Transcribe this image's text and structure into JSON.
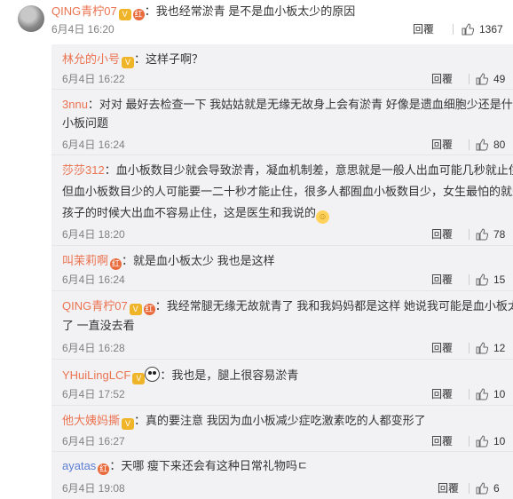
{
  "top_comment": {
    "user": "QING青柠07",
    "text": "：我也经常淤青 是不是血小板太少的原因",
    "time": "6月4日 16:20",
    "reply": "回覆",
    "likes": "1367"
  },
  "replies": [
    {
      "user": "林允的小号",
      "user_color": "#eb7350",
      "lines": [
        "：这样子啊？"
      ],
      "time": "6月4日 16:22",
      "reply": "回覆",
      "likes": "49"
    },
    {
      "user": "3nnu",
      "user_color": "#eb7350",
      "lines": [
        "：对对 最好去检查一下 我姑姑就是无缘无故身上会有淤青 好像是遗血细胞少还是什么血",
        "小板问题"
      ],
      "time": "6月4日 16:24",
      "reply": "回覆",
      "likes": "80"
    },
    {
      "user": "莎莎312",
      "user_color": "#eb7350",
      "lines": [
        "：血小板数目少就会导致淤青，凝血机制差，意思就是一般人出血可能几秒就止住，",
        "但血小板数目少的人可能要一二十秒才能止住，很多人都囿血小板数目少，女生最怕的就是生",
        "孩子的时候大出血不容易止住，这是医生和我说的"
      ],
      "time": "6月4日 18:20",
      "reply": "回覆",
      "likes": "78"
    },
    {
      "user": "叫茉莉啊",
      "user_color": "#eb7350",
      "lines": [
        "：就是血小板太少 我也是这样"
      ],
      "time": "6月4日 16:24",
      "reply": "回覆",
      "likes": "15"
    },
    {
      "user": "QING青柠07",
      "user_color": "#eb7350",
      "lines": [
        "：我经常腿无缘无故就青了 我和我妈妈都是这样 她说我可能是血小板太少",
        "了 一直没去看"
      ],
      "time": "6月4日 16:28",
      "reply": "回覆",
      "likes": "12"
    },
    {
      "user": "YHuiLingLCF",
      "user_color": "#eb7350",
      "lines": [
        "：我也是，腿上很容易淤青"
      ],
      "time": "6月4日 17:52",
      "reply": "回覆",
      "likes": "10"
    },
    {
      "user": "他大姨妈撕",
      "user_color": "#eb7350",
      "lines": [
        "：真的要注意 我因为血小板减少症吃激素吃的人都变形了"
      ],
      "time": "6月4日 16:27",
      "reply": "回覆",
      "likes": "10"
    },
    {
      "user": "ayatas",
      "user_color": "#5d7fd4",
      "lines": [
        "：天哪 瘦下来还会有这种日常礼物吗ㄷ"
      ],
      "time": "6月4日 19:08",
      "reply": "回覆",
      "likes": "6"
    }
  ]
}
